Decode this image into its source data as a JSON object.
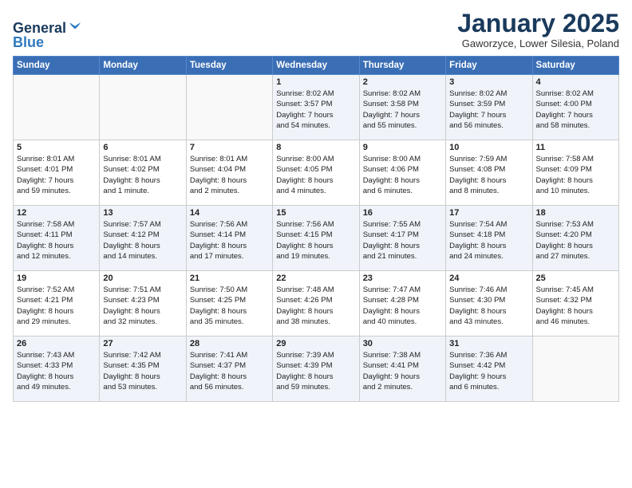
{
  "header": {
    "logo_general": "General",
    "logo_blue": "Blue",
    "month_title": "January 2025",
    "subtitle": "Gaworzyce, Lower Silesia, Poland"
  },
  "days_of_week": [
    "Sunday",
    "Monday",
    "Tuesday",
    "Wednesday",
    "Thursday",
    "Friday",
    "Saturday"
  ],
  "weeks": [
    [
      {
        "day": "",
        "info": ""
      },
      {
        "day": "",
        "info": ""
      },
      {
        "day": "",
        "info": ""
      },
      {
        "day": "1",
        "info": "Sunrise: 8:02 AM\nSunset: 3:57 PM\nDaylight: 7 hours\nand 54 minutes."
      },
      {
        "day": "2",
        "info": "Sunrise: 8:02 AM\nSunset: 3:58 PM\nDaylight: 7 hours\nand 55 minutes."
      },
      {
        "day": "3",
        "info": "Sunrise: 8:02 AM\nSunset: 3:59 PM\nDaylight: 7 hours\nand 56 minutes."
      },
      {
        "day": "4",
        "info": "Sunrise: 8:02 AM\nSunset: 4:00 PM\nDaylight: 7 hours\nand 58 minutes."
      }
    ],
    [
      {
        "day": "5",
        "info": "Sunrise: 8:01 AM\nSunset: 4:01 PM\nDaylight: 7 hours\nand 59 minutes."
      },
      {
        "day": "6",
        "info": "Sunrise: 8:01 AM\nSunset: 4:02 PM\nDaylight: 8 hours\nand 1 minute."
      },
      {
        "day": "7",
        "info": "Sunrise: 8:01 AM\nSunset: 4:04 PM\nDaylight: 8 hours\nand 2 minutes."
      },
      {
        "day": "8",
        "info": "Sunrise: 8:00 AM\nSunset: 4:05 PM\nDaylight: 8 hours\nand 4 minutes."
      },
      {
        "day": "9",
        "info": "Sunrise: 8:00 AM\nSunset: 4:06 PM\nDaylight: 8 hours\nand 6 minutes."
      },
      {
        "day": "10",
        "info": "Sunrise: 7:59 AM\nSunset: 4:08 PM\nDaylight: 8 hours\nand 8 minutes."
      },
      {
        "day": "11",
        "info": "Sunrise: 7:58 AM\nSunset: 4:09 PM\nDaylight: 8 hours\nand 10 minutes."
      }
    ],
    [
      {
        "day": "12",
        "info": "Sunrise: 7:58 AM\nSunset: 4:11 PM\nDaylight: 8 hours\nand 12 minutes."
      },
      {
        "day": "13",
        "info": "Sunrise: 7:57 AM\nSunset: 4:12 PM\nDaylight: 8 hours\nand 14 minutes."
      },
      {
        "day": "14",
        "info": "Sunrise: 7:56 AM\nSunset: 4:14 PM\nDaylight: 8 hours\nand 17 minutes."
      },
      {
        "day": "15",
        "info": "Sunrise: 7:56 AM\nSunset: 4:15 PM\nDaylight: 8 hours\nand 19 minutes."
      },
      {
        "day": "16",
        "info": "Sunrise: 7:55 AM\nSunset: 4:17 PM\nDaylight: 8 hours\nand 21 minutes."
      },
      {
        "day": "17",
        "info": "Sunrise: 7:54 AM\nSunset: 4:18 PM\nDaylight: 8 hours\nand 24 minutes."
      },
      {
        "day": "18",
        "info": "Sunrise: 7:53 AM\nSunset: 4:20 PM\nDaylight: 8 hours\nand 27 minutes."
      }
    ],
    [
      {
        "day": "19",
        "info": "Sunrise: 7:52 AM\nSunset: 4:21 PM\nDaylight: 8 hours\nand 29 minutes."
      },
      {
        "day": "20",
        "info": "Sunrise: 7:51 AM\nSunset: 4:23 PM\nDaylight: 8 hours\nand 32 minutes."
      },
      {
        "day": "21",
        "info": "Sunrise: 7:50 AM\nSunset: 4:25 PM\nDaylight: 8 hours\nand 35 minutes."
      },
      {
        "day": "22",
        "info": "Sunrise: 7:48 AM\nSunset: 4:26 PM\nDaylight: 8 hours\nand 38 minutes."
      },
      {
        "day": "23",
        "info": "Sunrise: 7:47 AM\nSunset: 4:28 PM\nDaylight: 8 hours\nand 40 minutes."
      },
      {
        "day": "24",
        "info": "Sunrise: 7:46 AM\nSunset: 4:30 PM\nDaylight: 8 hours\nand 43 minutes."
      },
      {
        "day": "25",
        "info": "Sunrise: 7:45 AM\nSunset: 4:32 PM\nDaylight: 8 hours\nand 46 minutes."
      }
    ],
    [
      {
        "day": "26",
        "info": "Sunrise: 7:43 AM\nSunset: 4:33 PM\nDaylight: 8 hours\nand 49 minutes."
      },
      {
        "day": "27",
        "info": "Sunrise: 7:42 AM\nSunset: 4:35 PM\nDaylight: 8 hours\nand 53 minutes."
      },
      {
        "day": "28",
        "info": "Sunrise: 7:41 AM\nSunset: 4:37 PM\nDaylight: 8 hours\nand 56 minutes."
      },
      {
        "day": "29",
        "info": "Sunrise: 7:39 AM\nSunset: 4:39 PM\nDaylight: 8 hours\nand 59 minutes."
      },
      {
        "day": "30",
        "info": "Sunrise: 7:38 AM\nSunset: 4:41 PM\nDaylight: 9 hours\nand 2 minutes."
      },
      {
        "day": "31",
        "info": "Sunrise: 7:36 AM\nSunset: 4:42 PM\nDaylight: 9 hours\nand 6 minutes."
      },
      {
        "day": "",
        "info": ""
      }
    ]
  ]
}
